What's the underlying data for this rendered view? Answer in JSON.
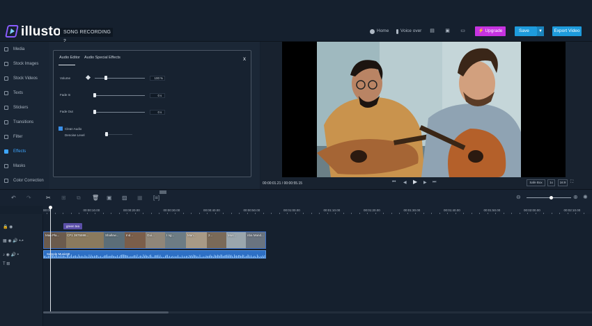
{
  "header": {
    "logo_text": "illusto",
    "project_title": "SONG RECORDING 2",
    "nav": {
      "home": "Home",
      "voice_over": "Voice over"
    },
    "upgrade_label": "Upgrade",
    "save_label": "Save",
    "export_label": "Export Video"
  },
  "sidebar": {
    "items": [
      {
        "label": "Media"
      },
      {
        "label": "Stock Images"
      },
      {
        "label": "Stock Videos"
      },
      {
        "label": "Texts"
      },
      {
        "label": "Stickers"
      },
      {
        "label": "Transitions"
      },
      {
        "label": "Filter"
      },
      {
        "label": "Effects",
        "active": true
      },
      {
        "label": "Masks"
      },
      {
        "label": "Color Correction"
      }
    ]
  },
  "audio_editor": {
    "tabs": [
      "Audio Editor",
      "Audio Special Effects"
    ],
    "close_label": "x",
    "volume_label": "Volume",
    "volume_value": "100",
    "volume_unit": "%",
    "volume_level": 0.22,
    "fade_in_label": "Fade In",
    "fade_in_value": "0",
    "fade_in_unit": "s",
    "fade_out_label": "Fade Out",
    "fade_out_value": "0",
    "fade_out_unit": "s",
    "clean_audio_label": "Clean Audio",
    "denoise_label": "Denoise Level"
  },
  "preview": {
    "current_time": "00:00:01.21",
    "separator": " / ",
    "total_time": "00:00:55.15",
    "safe_box_label": "Safe Box",
    "speed_label": "1x",
    "aspect_label": "16:9"
  },
  "timeline": {
    "zoom_level": 0.55,
    "ticks": [
      "00:00",
      "00:00:10.00",
      "00:00:20.00",
      "00:00:30.00",
      "00:00:40.00",
      "00:00:50.00",
      "00:01:00.00",
      "00:01:10.00",
      "00:01:20.00",
      "00:01:30.00",
      "00:01:40.00",
      "00:01:50.00",
      "00:02:00.00",
      "00:02:10.00"
    ],
    "text_clip_label": "green tea",
    "video_clip_labels": [
      "Man Pla...",
      "CP1 3875598...",
      "Shallow...",
      "Ind...",
      "Gui...",
      "I ng...",
      "Man...",
      "2...",
      "Mus...",
      "nba Mand..."
    ],
    "audio_clip_label": "Sample Music00"
  },
  "colors": {
    "accent": "#3ea6ff",
    "upgrade": "#c633e0",
    "save": "#1e9bdc",
    "audio_clip": "#2d6fc4"
  }
}
